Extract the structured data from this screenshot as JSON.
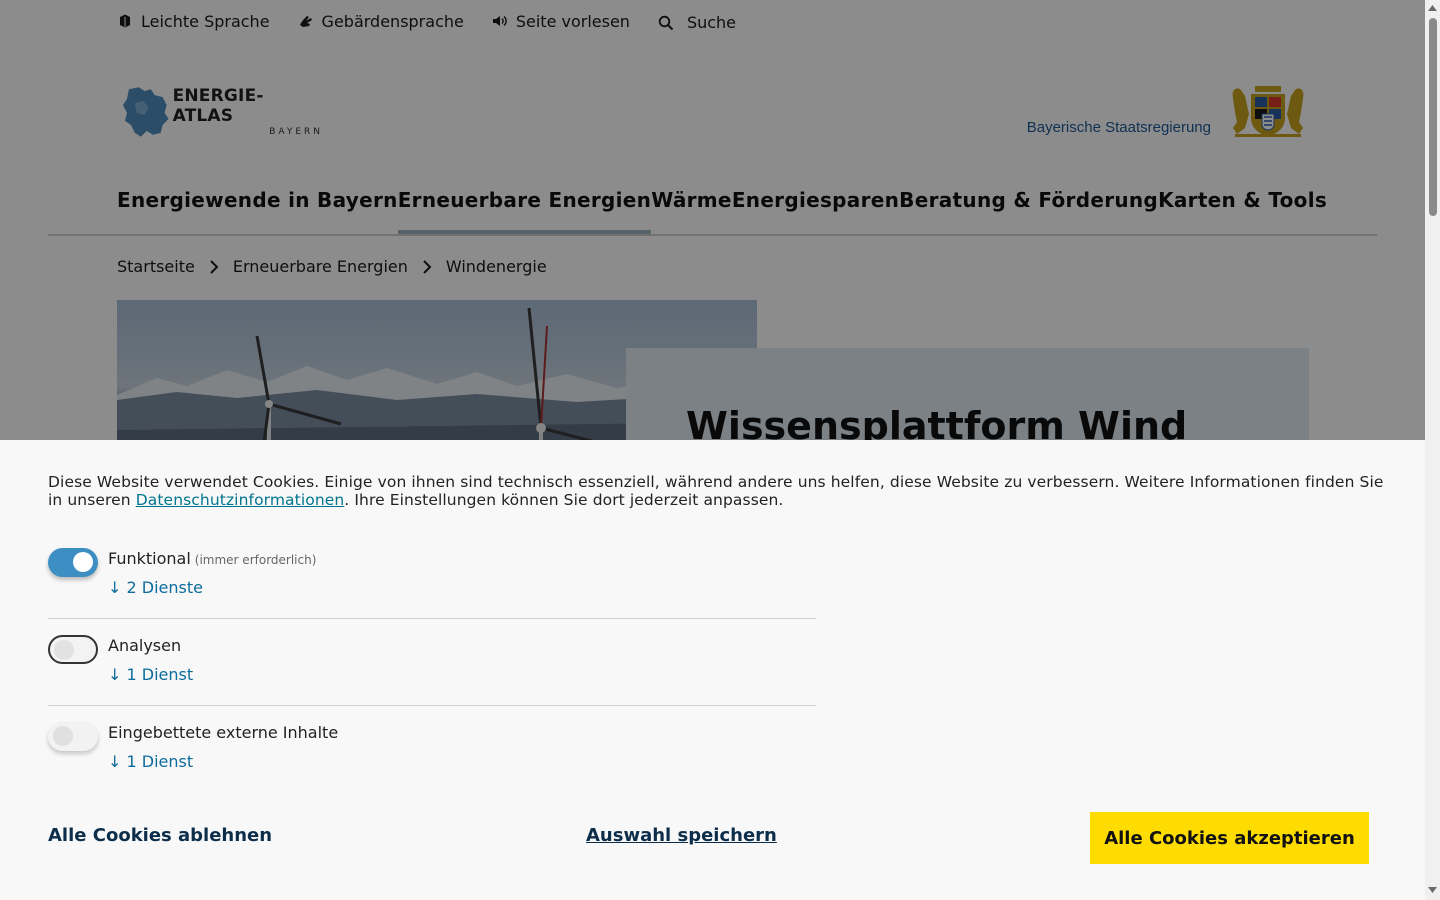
{
  "utility": {
    "items": [
      {
        "label": "Leichte Sprache",
        "icon": "easy-language-icon"
      },
      {
        "label": "Gebärdensprache",
        "icon": "sign-language-icon"
      },
      {
        "label": "Seite vorlesen",
        "icon": "speaker-icon"
      },
      {
        "label": "Suche",
        "icon": "search-icon"
      }
    ]
  },
  "header": {
    "logo_main": "ENERGIE-ATLAS",
    "logo_sub": "BAYERN",
    "gov_label": "Bayerische Staatsregierung"
  },
  "nav": {
    "items": [
      "Energiewende in Bayern",
      "Erneuerbare Energien",
      "Wärme",
      "Energiesparen",
      "Beratung & Förderung",
      "Karten & Tools"
    ],
    "active_index": 1
  },
  "breadcrumb": {
    "items": [
      "Startseite",
      "Erneuerbare Energien",
      "Windenergie"
    ]
  },
  "hero": {
    "title": "Wissensplattform Wind"
  },
  "cookie": {
    "text_before": "Diese Website verwendet Cookies. Einige von ihnen sind technisch essenziell, während andere uns helfen, diese Website zu verbessern. Weitere Informationen finden Sie in unseren ",
    "link": "Datenschutzinformationen",
    "text_after": ". Ihre Einstellungen können Sie dort jederzeit anpassen.",
    "categories": [
      {
        "title": "Funktional",
        "note": "(immer erforderlich)",
        "services": "↓ 2 Dienste",
        "enabled": true
      },
      {
        "title": "Analysen",
        "note": "",
        "services": "↓ 1 Dienst",
        "enabled": false
      },
      {
        "title": "Eingebettete externe Inhalte",
        "note": "",
        "services": "↓ 1 Dienst",
        "enabled": false
      }
    ],
    "reject_label": "Alle Cookies ablehnen",
    "save_label": "Auswahl speichern",
    "accept_label": "Alle Cookies akzeptieren"
  },
  "colors": {
    "accent_yellow": "#ffdc00",
    "toggle_on": "#3d8fc3",
    "link": "#00758f",
    "gov_blue": "#1f5a9a"
  }
}
